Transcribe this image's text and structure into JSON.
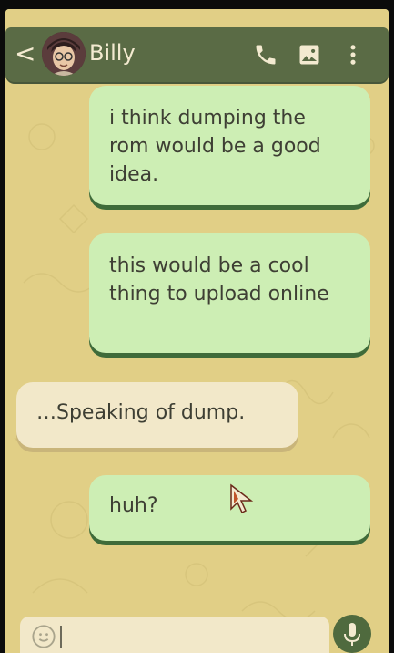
{
  "header": {
    "back_symbol": "<",
    "contact_name": "Billy",
    "icons": [
      "phone-icon",
      "image-icon",
      "more-vert-icon"
    ]
  },
  "messages": [
    {
      "direction": "outgoing",
      "text": "i think dumping the rom would be a good idea."
    },
    {
      "direction": "outgoing",
      "text": "this would be a cool thing to upload online"
    },
    {
      "direction": "incoming",
      "text": "…Speaking of dump."
    },
    {
      "direction": "outgoing",
      "text": "huh?"
    }
  ],
  "composer": {
    "value": "",
    "icons": [
      "emoji-icon",
      "mic-icon"
    ]
  },
  "colors": {
    "background": "#e1cf86",
    "header": "#5a6b45",
    "outgoing_bubble": "#cdeeb4",
    "outgoing_shadow": "#3f6b3a",
    "incoming_bubble": "#f2e8c9",
    "mic_button": "#4f6a3e"
  }
}
